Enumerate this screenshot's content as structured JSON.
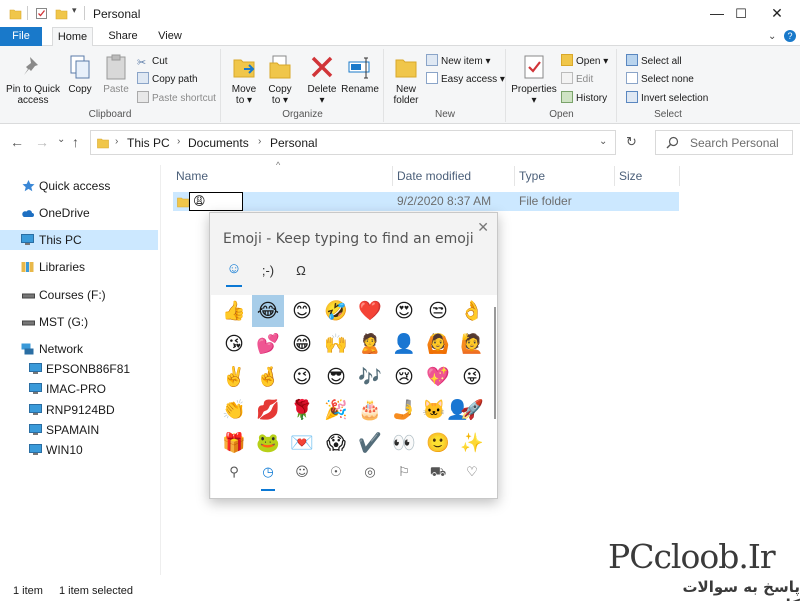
{
  "titlebar": {
    "title": "Personal",
    "minimize_glyph": "—",
    "maximize_glyph": "☐",
    "close_glyph": "✕"
  },
  "ribbon_tabs": {
    "file": "File",
    "home": "Home",
    "share": "Share",
    "view": "View",
    "expand_glyph": "⌄",
    "help_glyph": "?"
  },
  "ribbon": {
    "clipboard": {
      "label": "Clipboard",
      "pin_line1": "Pin to Quick",
      "pin_line2": "access",
      "copy": "Copy",
      "paste": "Paste",
      "cut": "Cut",
      "copy_path": "Copy path",
      "paste_shortcut": "Paste shortcut"
    },
    "organize": {
      "label": "Organize",
      "move_to_line1": "Move",
      "move_to_line2": "to ▾",
      "copy_to_line1": "Copy",
      "copy_to_line2": "to ▾",
      "delete_line1": "Delete",
      "delete_line2": "▾",
      "rename": "Rename"
    },
    "new": {
      "label": "New",
      "new_folder_line1": "New",
      "new_folder_line2": "folder",
      "new_item": "New item ▾",
      "easy_access": "Easy access ▾"
    },
    "open": {
      "label": "Open",
      "properties_line1": "Properties",
      "properties_line2": "▾",
      "open": "Open ▾",
      "edit": "Edit",
      "history": "History"
    },
    "select": {
      "label": "Select",
      "select_all": "Select all",
      "select_none": "Select none",
      "invert_selection": "Invert selection"
    }
  },
  "address": {
    "back_glyph": "←",
    "forward_glyph": "→",
    "recent_glyph": "⌄",
    "up_glyph": "↑",
    "crumbs": [
      "This PC",
      "Documents",
      "Personal"
    ],
    "sep": "›",
    "dropdown_glyph": "⌄",
    "refresh_glyph": "↻",
    "search_placeholder": "Search Personal"
  },
  "nav": {
    "items": [
      {
        "label": "Quick access",
        "icon": "star-icon",
        "color": "#3a87d6"
      },
      {
        "label": "OneDrive",
        "icon": "cloud-icon",
        "color": "#1e6fc1"
      },
      {
        "label": "This PC",
        "icon": "computer-icon",
        "color": "#3a9ad9"
      },
      {
        "label": "Libraries",
        "icon": "library-icon",
        "color": "#e8b84a"
      },
      {
        "label": "Courses (F:)",
        "icon": "drive-icon",
        "color": "#555555"
      },
      {
        "label": "MST (G:)",
        "icon": "drive-icon",
        "color": "#555555"
      },
      {
        "label": "Network",
        "icon": "network-icon",
        "color": "#3a9ad9"
      },
      {
        "label": "EPSONB86F81",
        "icon": "computer-icon",
        "color": "#3a9ad9"
      },
      {
        "label": "IMAC-PRO",
        "icon": "computer-icon",
        "color": "#3a9ad9"
      },
      {
        "label": "RNP9124BD",
        "icon": "computer-icon",
        "color": "#3a9ad9"
      },
      {
        "label": "SPAMAIN",
        "icon": "computer-icon",
        "color": "#3a9ad9"
      },
      {
        "label": "WIN10",
        "icon": "computer-icon",
        "color": "#3a9ad9"
      }
    ],
    "selected": "This PC"
  },
  "columns": {
    "name": "Name",
    "date_modified": "Date modified",
    "type": "Type",
    "size": "Size",
    "sort_glyph": "^"
  },
  "file": {
    "name_value": "😩",
    "date": "9/2/2020 8:37 AM",
    "type": "File folder"
  },
  "emoji_panel": {
    "title": "Emoji - Keep typing to find an emoji",
    "close_glyph": "✕",
    "tabs": [
      "☺",
      ";-)",
      "Ω"
    ],
    "rows": [
      [
        "👍",
        "😂",
        "😊",
        "🤣",
        "❤️",
        "😍",
        "😒",
        "👌"
      ],
      [
        "😘",
        "💕",
        "😁",
        "🙌",
        "🙎",
        "👤",
        "🙆",
        "🙋"
      ],
      [
        "✌️",
        "🤞",
        "😉",
        "😎",
        "🎶",
        "😢",
        "💖",
        "😜"
      ],
      [
        "👏",
        "💋",
        "🌹",
        "🎉",
        "🎂",
        "🤳",
        "🐱‍👤",
        "🚀"
      ],
      [
        "🎁",
        "🐸",
        "💌",
        "😱",
        "✔️",
        "👀",
        "🙂",
        "✨"
      ]
    ],
    "selected_emoji": "😂",
    "categories": [
      "⚲",
      "◷",
      "☺",
      "☉",
      "◎",
      "⚐",
      "⛟",
      "♡"
    ]
  },
  "status": {
    "items": "1 item",
    "selected": "1 item selected"
  },
  "watermark": {
    "title": "PCcloob.Ir",
    "subtitle": "پاسخ به سوالات کامپیوتری"
  }
}
